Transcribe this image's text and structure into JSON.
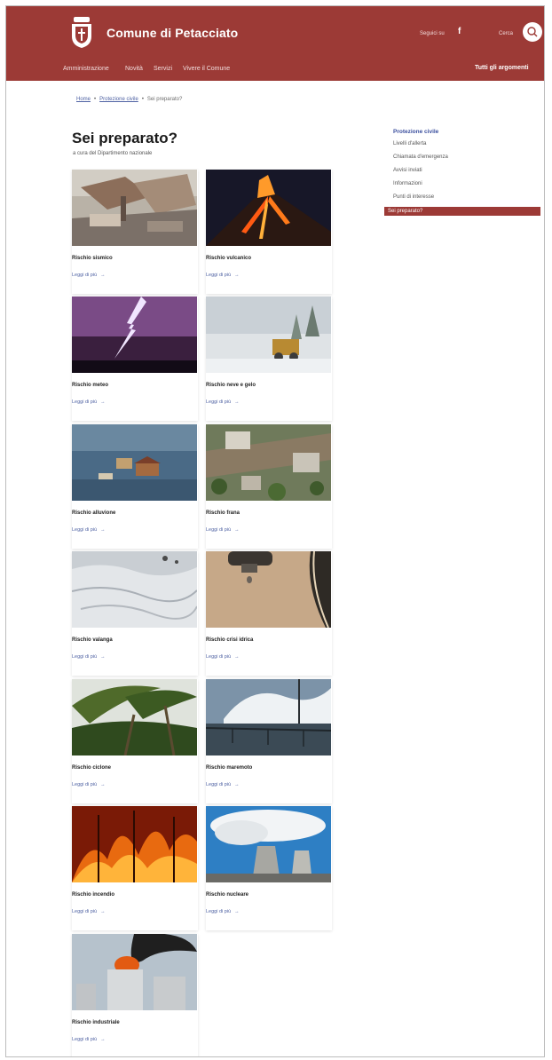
{
  "header": {
    "site_title": "Comune di Petacciato",
    "signin": "Seguici su",
    "facebook_icon": "f",
    "search_label": "Cerca",
    "search_icon": "search-icon",
    "nav": [
      "Amministrazione",
      "Novità",
      "Servizi",
      "Vivere il Comune"
    ],
    "topics": "Tutti gli argomenti",
    "brand_color": "#9c3a36"
  },
  "breadcrumb": {
    "items": [
      "Home",
      "Protezione civile",
      "Sei preparato?"
    ]
  },
  "page": {
    "title": "Sei preparato?",
    "subtitle": "a cura del Dipartimento nazionale"
  },
  "sidebar": {
    "heading": "Protezione civile",
    "items": [
      "Livelli d'allerta",
      "Chiamata d'emergenza",
      "Avvisi inviati",
      "Informazioni",
      "Punti di interesse",
      "Sei preparato?"
    ],
    "active_index": 5
  },
  "cards": [
    {
      "title": "Rischio sismico",
      "link": "Leggi di più",
      "image": "collapsed-building"
    },
    {
      "title": "Rischio vulcanico",
      "link": "Leggi di più",
      "image": "erupting-volcano"
    },
    {
      "title": "Rischio meteo",
      "link": "Leggi di più",
      "image": "lightning-storm"
    },
    {
      "title": "Rischio neve e gelo",
      "link": "Leggi di più",
      "image": "snowplow"
    },
    {
      "title": "Rischio alluvione",
      "link": "Leggi di più",
      "image": "flooded-houses"
    },
    {
      "title": "Rischio frana",
      "link": "Leggi di più",
      "image": "landslide"
    },
    {
      "title": "Rischio valanga",
      "link": "Leggi di più",
      "image": "avalanche-snow"
    },
    {
      "title": "Rischio crisi idrica",
      "link": "Leggi di più",
      "image": "dripping-tap"
    },
    {
      "title": "Rischio ciclone",
      "link": "Leggi di più",
      "image": "palm-trees-wind"
    },
    {
      "title": "Rischio maremoto",
      "link": "Leggi di più",
      "image": "sea-waves"
    },
    {
      "title": "Rischio incendio",
      "link": "Leggi di più",
      "image": "forest-fire"
    },
    {
      "title": "Rischio nucleare",
      "link": "Leggi di più",
      "image": "cooling-towers"
    },
    {
      "title": "Rischio industriale",
      "link": "Leggi di più",
      "image": "burning-tanks"
    }
  ]
}
